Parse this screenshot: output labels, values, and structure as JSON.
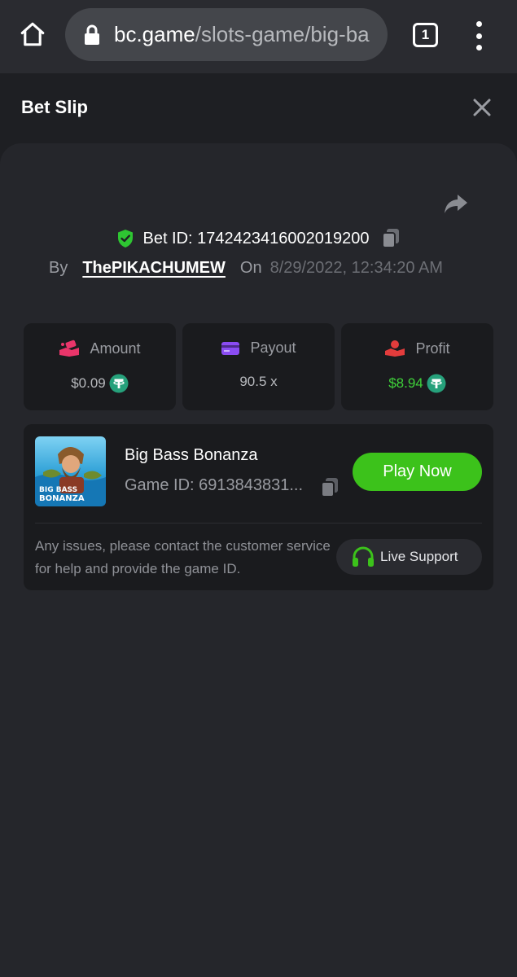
{
  "browser": {
    "url_domain": "bc.game",
    "url_path": "/slots-game/big-ba",
    "tab_count": "1"
  },
  "header": {
    "title": "Bet Slip"
  },
  "bet": {
    "bet_id_label": "Bet ID: 1742423416002019200",
    "by_label": "By",
    "username": "ThePIKACHUMEW",
    "on_label": "On",
    "date": "8/29/2022, 12:34:20 AM"
  },
  "stats": [
    {
      "label": "Amount",
      "value": "$0.09",
      "icon": "money-hand-icon",
      "color": "#e9356a"
    },
    {
      "label": "Payout",
      "value": "90.5 x",
      "icon": "card-icon",
      "color": "#8a4cf2"
    },
    {
      "label": "Profit",
      "value": "$8.94",
      "icon": "profit-hand-icon",
      "color": "#e33c3c"
    }
  ],
  "game": {
    "name": "Big Bass Bonanza",
    "game_id": "Game ID: 6913843831...",
    "play_label": "Play Now",
    "thumb_text_1": "BIG BASS",
    "thumb_text_2": "BONANZA"
  },
  "support": {
    "text": "Any issues, please contact the customer service for help and provide the game ID.",
    "button_label": "Live Support"
  },
  "colors": {
    "accent_green": "#3cc21b",
    "profit_green": "#3fd13a",
    "usdt": "#26a17b"
  }
}
